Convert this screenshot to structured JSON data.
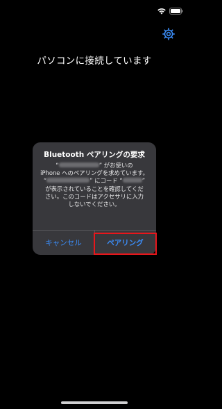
{
  "status_bar": {
    "wifi_icon": "wifi-icon",
    "battery_icon": "battery-icon"
  },
  "header": {
    "settings_icon": "gear-icon"
  },
  "title": "パソコンに接続しています",
  "alert": {
    "title": "Bluetooth ペアリングの要求",
    "message": {
      "line1_prefix": "“",
      "line1_suffix": "” がお使いの",
      "line2": "iPhone へのペアリングを求めています。",
      "line3_prefix": "“",
      "line3_middle": "” にコード “",
      "line3_suffix": "”",
      "line4": "が表示されていることを確認してくだ",
      "line5": "さい。このコードはアクセサリに入力",
      "line6": "しないでください。"
    },
    "cancel_label": "キャンセル",
    "pair_label": "ペアリング"
  },
  "colors": {
    "accent": "#3b8cf6",
    "highlight": "#e8161b"
  }
}
